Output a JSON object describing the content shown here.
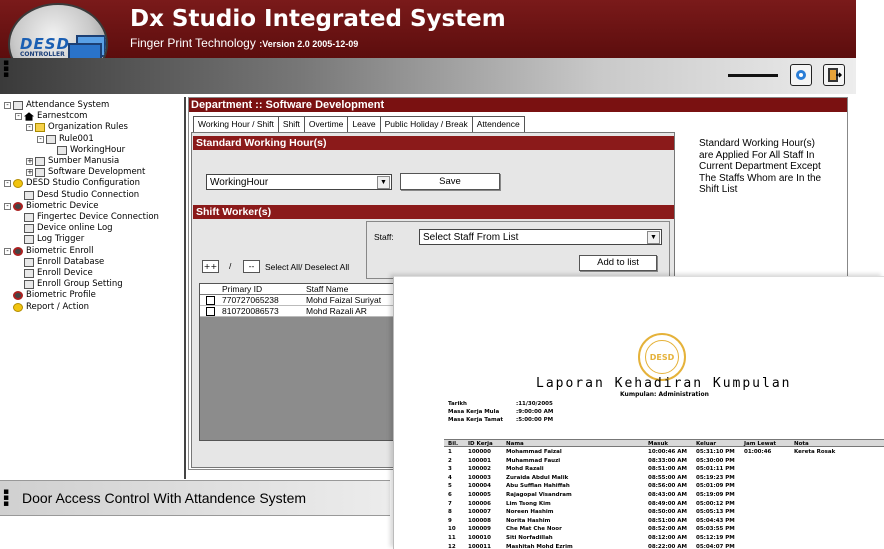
{
  "header": {
    "logo_text": "DESD",
    "logo_sub": "CONTROLLER",
    "title": "Dx Studio Integrated System",
    "subtitle": "Finger Print Technology",
    "version": ":Version 2.0 2005-12-09"
  },
  "toolbar": {
    "btn1_icon": "circle-icon",
    "btn2_icon": "exit-door-icon"
  },
  "tree": [
    {
      "label": "Attendance System",
      "level": 0,
      "pm": "-",
      "icon": "network"
    },
    {
      "label": "Earnestcom",
      "level": 1,
      "pm": "-",
      "icon": "house"
    },
    {
      "label": "Organization Rules",
      "level": 2,
      "pm": "-",
      "icon": "folder"
    },
    {
      "label": "Rule001",
      "level": 3,
      "pm": "-",
      "icon": "doc"
    },
    {
      "label": "WorkingHour",
      "level": 4,
      "pm": "",
      "icon": "tools"
    },
    {
      "label": "Sumber Manusia",
      "level": 2,
      "pm": "+",
      "icon": "doc"
    },
    {
      "label": "Software Development",
      "level": 2,
      "pm": "+",
      "icon": "doc"
    },
    {
      "label": "DESD Studio Configuration",
      "level": 0,
      "pm": "-",
      "icon": "yellow"
    },
    {
      "label": "Desd Studio Connection",
      "level": 1,
      "pm": "",
      "icon": "doc"
    },
    {
      "label": "Biometric Device",
      "level": 0,
      "pm": "-",
      "icon": "gear"
    },
    {
      "label": "Fingertec Device Connection",
      "level": 1,
      "pm": "",
      "icon": "doc"
    },
    {
      "label": "Device online Log",
      "level": 1,
      "pm": "",
      "icon": "doc"
    },
    {
      "label": "Log Trigger",
      "level": 1,
      "pm": "",
      "icon": "doc"
    },
    {
      "label": "Biometric Enroll",
      "level": 0,
      "pm": "-",
      "icon": "gear"
    },
    {
      "label": "Enroll Database",
      "level": 1,
      "pm": "",
      "icon": "doc"
    },
    {
      "label": "Enroll Device",
      "level": 1,
      "pm": "",
      "icon": "doc"
    },
    {
      "label": "Enroll Group Setting",
      "level": 1,
      "pm": "",
      "icon": "doc"
    },
    {
      "label": "Biometric Profile",
      "level": 0,
      "pm": "",
      "icon": "gear"
    },
    {
      "label": "Report / Action",
      "level": 0,
      "pm": "",
      "icon": "yellow"
    }
  ],
  "panel": {
    "title": "Department :: Software Development",
    "tabs": [
      "Working Hour / Shift",
      "Shift",
      "Overtime",
      "Leave",
      "Public Holiday / Break",
      "Attendence"
    ],
    "section1": "Standard Working Hour(s)",
    "working_hour_select": "WorkingHour",
    "save_label": "Save",
    "section2": "Shift Worker(s)",
    "staff_label": "Staff:",
    "staff_select": "Select Staff From List",
    "add_label": "Add to list",
    "plus_label": "++",
    "slash_label": "/",
    "minus_label": "--",
    "select_all_label": "Select All/ Deselect All",
    "grid_headers": [
      "Primary ID",
      "Staff Name"
    ],
    "grid_rows": [
      {
        "id": "770727065238",
        "name": "Mohd Faizal Suriyat"
      },
      {
        "id": "810720086573",
        "name": "Mohd Razali AR"
      }
    ],
    "info": "Standard Working Hour(s) are Applied For All Staff In Current Department Except The Staffs Whom are In the Shift List"
  },
  "footer": {
    "text": "Door Access Control With Attandence System"
  },
  "report": {
    "logo": "DESD",
    "title": "Laporan Kehadiran Kumpulan",
    "subtitle": "Kumpulan: Administration",
    "meta": [
      {
        "label": "Tarikh",
        "value": ":11/30/2005"
      },
      {
        "label": "Masa Kerja Mula",
        "value": ":9:00:00 AM"
      },
      {
        "label": "Masa Kerja Tamat",
        "value": ":5:00:00 PM"
      }
    ],
    "headers": [
      "Bil.",
      "ID Kerja",
      "Nama",
      "Masuk",
      "Keluar",
      "Jam Lewat",
      "Nota"
    ],
    "rows": [
      [
        "1",
        "100000",
        "Mohammad Faizal",
        "10:00:46 AM",
        "05:31:10 PM",
        "01:00:46",
        "Kereta Rosak"
      ],
      [
        "2",
        "100001",
        "Muhammad Fauzi",
        "08:33:00 AM",
        "05:30:00 PM",
        "",
        ""
      ],
      [
        "3",
        "100002",
        "Mohd Razali",
        "08:51:00 AM",
        "05:01:11 PM",
        "",
        ""
      ],
      [
        "4",
        "100003",
        "Zuraida Abdul Malik",
        "08:55:00 AM",
        "05:19:23 PM",
        "",
        ""
      ],
      [
        "5",
        "100004",
        "Abu Sufflan Hahiffah",
        "08:56:00 AM",
        "05:01:09 PM",
        "",
        ""
      ],
      [
        "6",
        "100005",
        "Rajagopal Visandram",
        "08:43:00 AM",
        "05:19:09 PM",
        "",
        ""
      ],
      [
        "7",
        "100006",
        "Lim Tsong Kim",
        "08:49:00 AM",
        "05:00:12 PM",
        "",
        ""
      ],
      [
        "8",
        "100007",
        "Noreen Hashim",
        "08:50:00 AM",
        "05:05:13 PM",
        "",
        ""
      ],
      [
        "9",
        "100008",
        "Norita Hashim",
        "08:51:00 AM",
        "05:04:43 PM",
        "",
        ""
      ],
      [
        "10",
        "100009",
        "Che Mat Che Noor",
        "08:52:00 AM",
        "05:03:55 PM",
        "",
        ""
      ],
      [
        "11",
        "100010",
        "Siti Norfadillah",
        "08:12:00 AM",
        "05:12:19 PM",
        "",
        ""
      ],
      [
        "12",
        "100011",
        "Mashitah Mohd Ezrim",
        "08:22:00 AM",
        "05:04:07 PM",
        "",
        ""
      ]
    ]
  }
}
